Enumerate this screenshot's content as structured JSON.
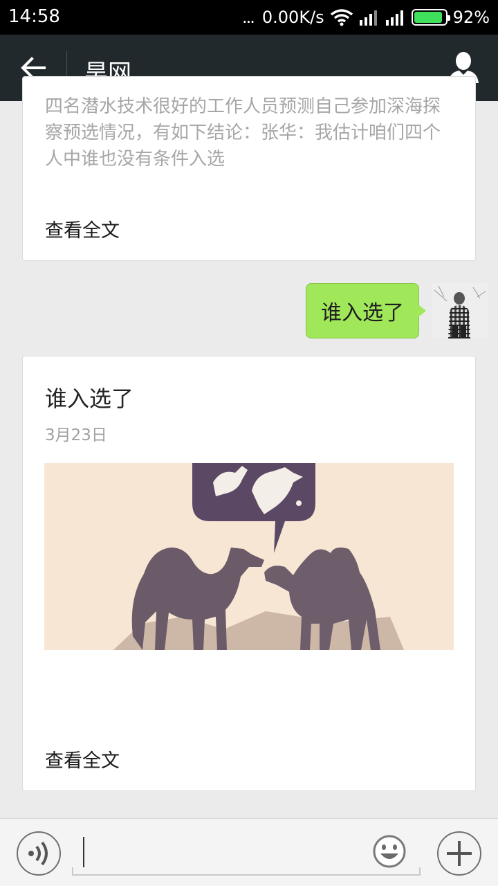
{
  "status_bar": {
    "time": "14:58",
    "dots": "...",
    "network_speed": "0.00K/s",
    "battery_percent": "92%",
    "battery_level": 0.92,
    "icons": [
      "wifi-icon",
      "signal-icon",
      "signal-icon",
      "battery-icon"
    ]
  },
  "title_bar": {
    "title": "昊网",
    "back_icon": "arrow-left-icon",
    "profile_icon": "person-icon"
  },
  "messages": {
    "article1": {
      "excerpt": "四名潜水技术很好的工作人员预测自己参加深海探察预选情况，有如下结论：张华：我估计咱们四个人中谁也没有条件入选",
      "read_more": "查看全文"
    },
    "sent": {
      "text": "谁入选了"
    },
    "article2": {
      "title": "谁入选了",
      "date": "3月23日",
      "read_more": "查看全文"
    }
  },
  "input_bar": {
    "voice_icon": "voice-icon",
    "emoji_icon": "smiley-icon",
    "plus_icon": "plus-icon"
  },
  "colors": {
    "title_bar_bg": "#22292c",
    "bubble_green": "#a0e75a",
    "battery_green": "#3ee05c"
  }
}
